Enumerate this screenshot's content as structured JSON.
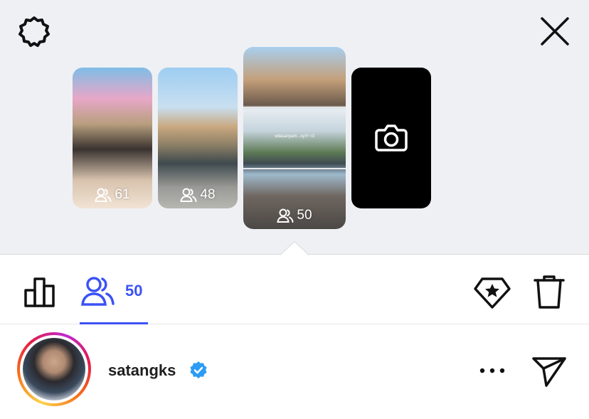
{
  "header": {
    "settings_icon": "gear-icon",
    "close_icon": "close-icon"
  },
  "stories": [
    {
      "viewers": "61",
      "icon": "people-icon"
    },
    {
      "viewers": "48",
      "icon": "people-icon"
    },
    {
      "viewers": "50",
      "icon": "people-icon",
      "caption": "wilasanyam...sy!!! <3",
      "selected": true
    },
    {
      "type": "add-story",
      "icon": "camera-icon"
    }
  ],
  "tabs": {
    "stats_icon": "bar-chart-icon",
    "viewers_icon": "people-icon",
    "viewers_count": "50",
    "accent": "#3b52f6",
    "highlight_icon": "star-diamond-icon",
    "delete_icon": "trash-icon"
  },
  "viewer_list": [
    {
      "username": "satangks",
      "verified": true,
      "verified_color": "#2d9cf4",
      "more_icon": "more-horizontal-icon",
      "send_icon": "send-icon"
    }
  ]
}
